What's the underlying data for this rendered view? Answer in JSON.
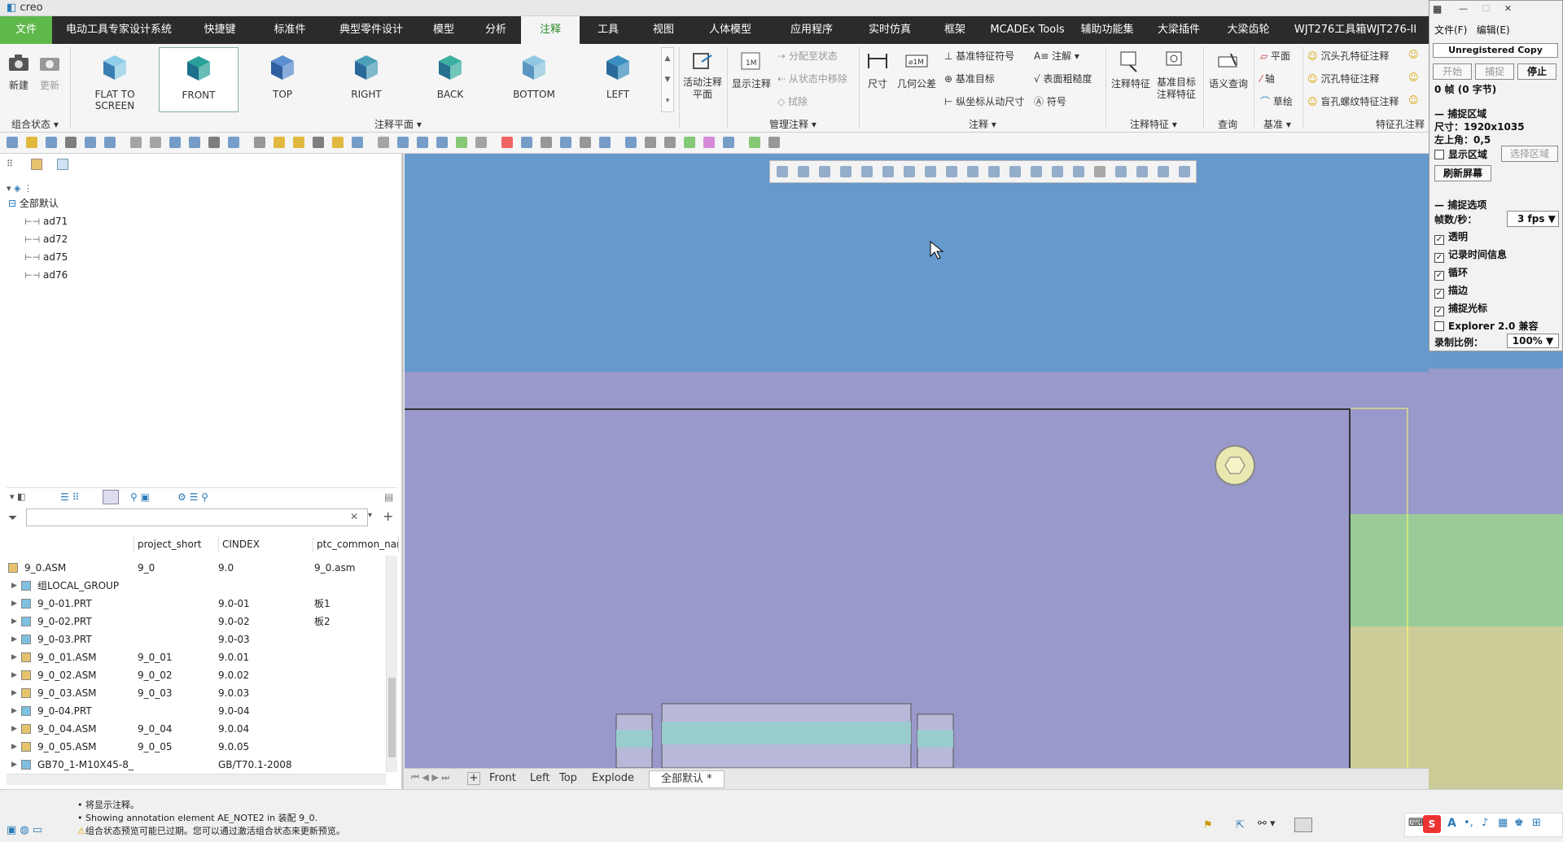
{
  "app": {
    "logo": "creo"
  },
  "menu": {
    "file": "文件",
    "tabs": [
      "电动工具专家设计系统",
      "快捷键",
      "标准件",
      "典型零件设计",
      "模型",
      "分析",
      "注释",
      "工具",
      "视图",
      "人体模型",
      "应用程序",
      "实时仿真",
      "框架",
      "MCADEx Tools",
      "辅助功能集",
      "大梁插件",
      "大梁齿轮",
      "WJT276工具箱WJT276-II"
    ],
    "active": "注释"
  },
  "ribbon": {
    "new": "新建",
    "update": "更新",
    "group_combo": "组合状态",
    "planes": [
      "FLAT TO SCREEN",
      "FRONT",
      "TOP",
      "RIGHT",
      "BACK",
      "BOTTOM",
      "LEFT"
    ],
    "selected_plane": "FRONT",
    "group_plane": "注释平面",
    "active_plane": "活动注释平面",
    "show_annot": "显示注释",
    "assign_state": "分配至状态",
    "remove_state": "从状态中移除",
    "erase": "拭除",
    "group_manage": "管理注释",
    "dimension": "尺寸",
    "gtol": "几何公差",
    "datum_feature_symbol": "基准特征符号",
    "datum_target": "基准目标",
    "ordinate_dim": "纵坐标从动尺寸",
    "note": "注解",
    "surface_finish": "表面粗糙度",
    "symbol": "符号",
    "group_annot": "注释",
    "annot_feature": "注释特征",
    "datum_target_feature": "基准目标注释特征",
    "group_annot_feature": "注释特征",
    "semantic_query": "语义查询",
    "group_query": "查询",
    "plane": "平面",
    "axis": "轴",
    "sketch": "草绘",
    "group_datum": "基准",
    "countersink": "沉头孔特征注释",
    "counterbore": "沉孔特征注释",
    "blind_thread": "盲孔螺纹特征注释",
    "group_hole": "特征孔注释"
  },
  "tree_top": {
    "root": "全部默认",
    "items": [
      "ad71",
      "ad72",
      "ad75",
      "ad76"
    ]
  },
  "model_tree": {
    "filter_placeholder": "",
    "columns": [
      "project_short",
      "CINDEX",
      "ptc_common_nan"
    ],
    "rows": [
      {
        "name": "9_0.ASM",
        "short": "9_0",
        "cindex": "9.0",
        "common": "9_0.asm"
      },
      {
        "name": "组LOCAL_GROUP",
        "short": "",
        "cindex": "",
        "common": ""
      },
      {
        "name": "9_0-01.PRT",
        "short": "",
        "cindex": "9.0-01",
        "common": "板1"
      },
      {
        "name": "9_0-02.PRT",
        "short": "",
        "cindex": "9.0-02",
        "common": "板2"
      },
      {
        "name": "9_0-03.PRT",
        "short": "",
        "cindex": "9.0-03",
        "common": ""
      },
      {
        "name": "9_0_01.ASM",
        "short": "9_0_01",
        "cindex": "9.0.01",
        "common": ""
      },
      {
        "name": "9_0_02.ASM",
        "short": "9_0_02",
        "cindex": "9.0.02",
        "common": ""
      },
      {
        "name": "9_0_03.ASM",
        "short": "9_0_03",
        "cindex": "9.0.03",
        "common": ""
      },
      {
        "name": "9_0-04.PRT",
        "short": "",
        "cindex": "9.0-04",
        "common": ""
      },
      {
        "name": "9_0_04.ASM",
        "short": "9_0_04",
        "cindex": "9.0.04",
        "common": ""
      },
      {
        "name": "9_0_05.ASM",
        "short": "9_0_05",
        "cindex": "9.0.05",
        "common": ""
      },
      {
        "name": "GB70_1-M10X45-8_",
        "short": "",
        "cindex": "GB/T70.1-2008",
        "common": ""
      }
    ]
  },
  "view_tabs": [
    "Front",
    "Left",
    "Top",
    "Explode",
    "全部默认 *"
  ],
  "status": {
    "msg1": "将显示注释。",
    "msg2": "Showing annotation element AE_NOTE2 in 装配 9_0.",
    "msg3": "组合状态预览可能已过期。您可以通过激活组合状态来更新预览。"
  },
  "capture": {
    "menu_file": "文件(F)",
    "menu_edit": "编辑(E)",
    "unregistered": "Unregistered Copy",
    "start": "开始",
    "capture": "捕捉",
    "stop": "停止",
    "frames": "0 帧 (0 字节)",
    "region_title": "捕捉区域",
    "size": "尺寸：1920x1035",
    "topleft": "左上角：0,5",
    "show_region": "显示区域",
    "select_region": "选择区域",
    "refresh": "刷新屏幕",
    "options_title": "捕捉选项",
    "fps_label": "帧数/秒：",
    "fps": "3 fps",
    "transparent": "透明",
    "record_time": "记录时间信息",
    "loop": "循环",
    "border": "描边",
    "cursor": "捕捉光标",
    "explorer": "Explorer 2.0 兼容",
    "ratio_label": "录制比例：",
    "ratio": "100%"
  },
  "colors": {
    "menubar": "#2b2b2b",
    "file_tab": "#5fb84a",
    "active_tab_text": "#2e8b2e",
    "bg_blue": "#6699cc",
    "bg_lavender": "#9999cc",
    "green_block": "#99cc99",
    "khaki_block": "#cccc99",
    "cyl_teal": "#99cccc"
  }
}
